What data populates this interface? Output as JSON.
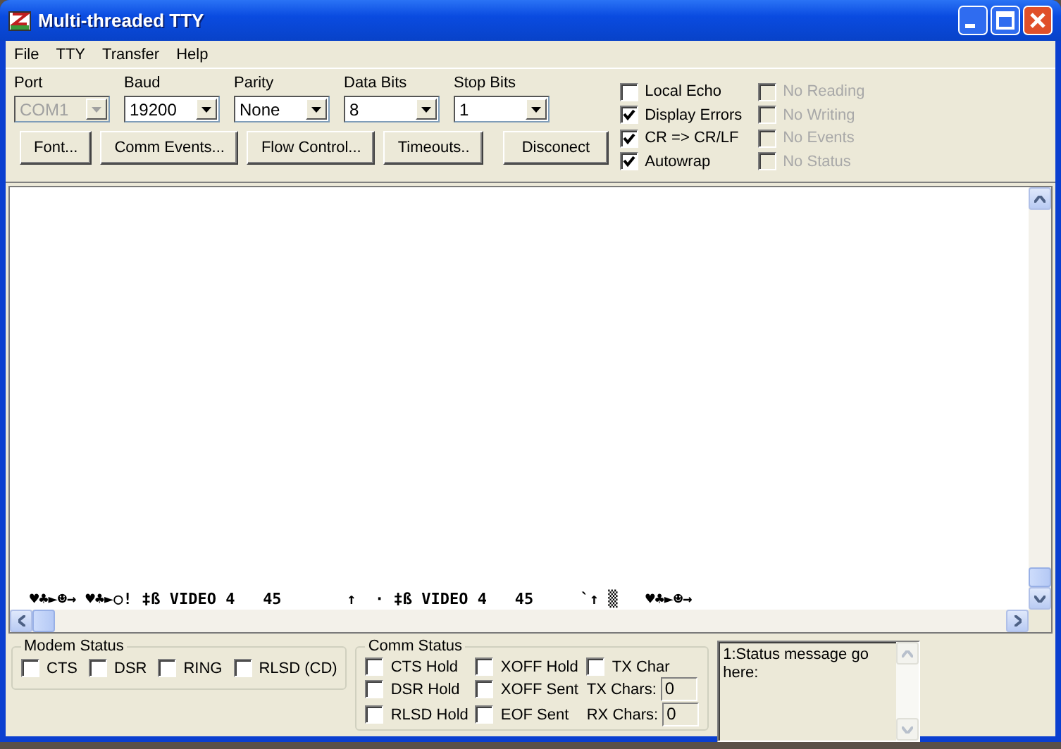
{
  "window": {
    "title": "Multi-threaded TTY"
  },
  "menu": [
    "File",
    "TTY",
    "Transfer",
    "Help"
  ],
  "settings": [
    {
      "label": "Port",
      "value": "COM1",
      "disabled": true
    },
    {
      "label": "Baud",
      "value": "19200",
      "disabled": false
    },
    {
      "label": "Parity",
      "value": "None",
      "disabled": false
    },
    {
      "label": "Data Bits",
      "value": "8",
      "disabled": false
    },
    {
      "label": "Stop Bits",
      "value": "1",
      "disabled": false
    }
  ],
  "buttons": [
    "Font...",
    "Comm Events...",
    "Flow Control...",
    "Timeouts..",
    "Disconect"
  ],
  "options": [
    {
      "label": "Local Echo",
      "checked": false,
      "disabled": false
    },
    {
      "label": "Display Errors",
      "checked": true,
      "disabled": false
    },
    {
      "label": "CR => CR/LF",
      "checked": true,
      "disabled": false
    },
    {
      "label": "Autowrap",
      "checked": true,
      "disabled": false
    },
    {
      "label": "No Reading",
      "checked": false,
      "disabled": true
    },
    {
      "label": "No Writing",
      "checked": false,
      "disabled": true
    },
    {
      "label": "No Events",
      "checked": false,
      "disabled": true
    },
    {
      "label": "No Status",
      "checked": false,
      "disabled": true
    }
  ],
  "terminal": {
    "lines": [
      "♥♣►☻→ ♥♣►○! ‡ß VIDEO 4   45       ↑  · ‡ß VIDEO 4   45     `↑ ▒   ♥♣►☻→"
    ]
  },
  "modem_status": {
    "title": "Modem Status",
    "flags": [
      {
        "label": "CTS",
        "checked": false
      },
      {
        "label": "DSR",
        "checked": false
      },
      {
        "label": "RING",
        "checked": false
      },
      {
        "label": "RLSD (CD)",
        "checked": false
      }
    ]
  },
  "comm_status": {
    "title": "Comm Status",
    "items": [
      {
        "kind": "check",
        "label": "CTS Hold",
        "checked": false
      },
      {
        "kind": "check",
        "label": "XOFF Hold",
        "checked": false
      },
      {
        "kind": "check",
        "label": "TX Char",
        "checked": false
      },
      {
        "kind": "check",
        "label": "DSR Hold",
        "checked": false
      },
      {
        "kind": "check",
        "label": "XOFF Sent",
        "checked": false
      },
      {
        "kind": "field",
        "label": "TX Chars:",
        "value": "0"
      },
      {
        "kind": "check",
        "label": "RLSD Hold",
        "checked": false
      },
      {
        "kind": "check",
        "label": "EOF Sent",
        "checked": false
      },
      {
        "kind": "field",
        "label": "RX Chars:",
        "value": "0"
      }
    ]
  },
  "status_message": "1:Status message go here:"
}
